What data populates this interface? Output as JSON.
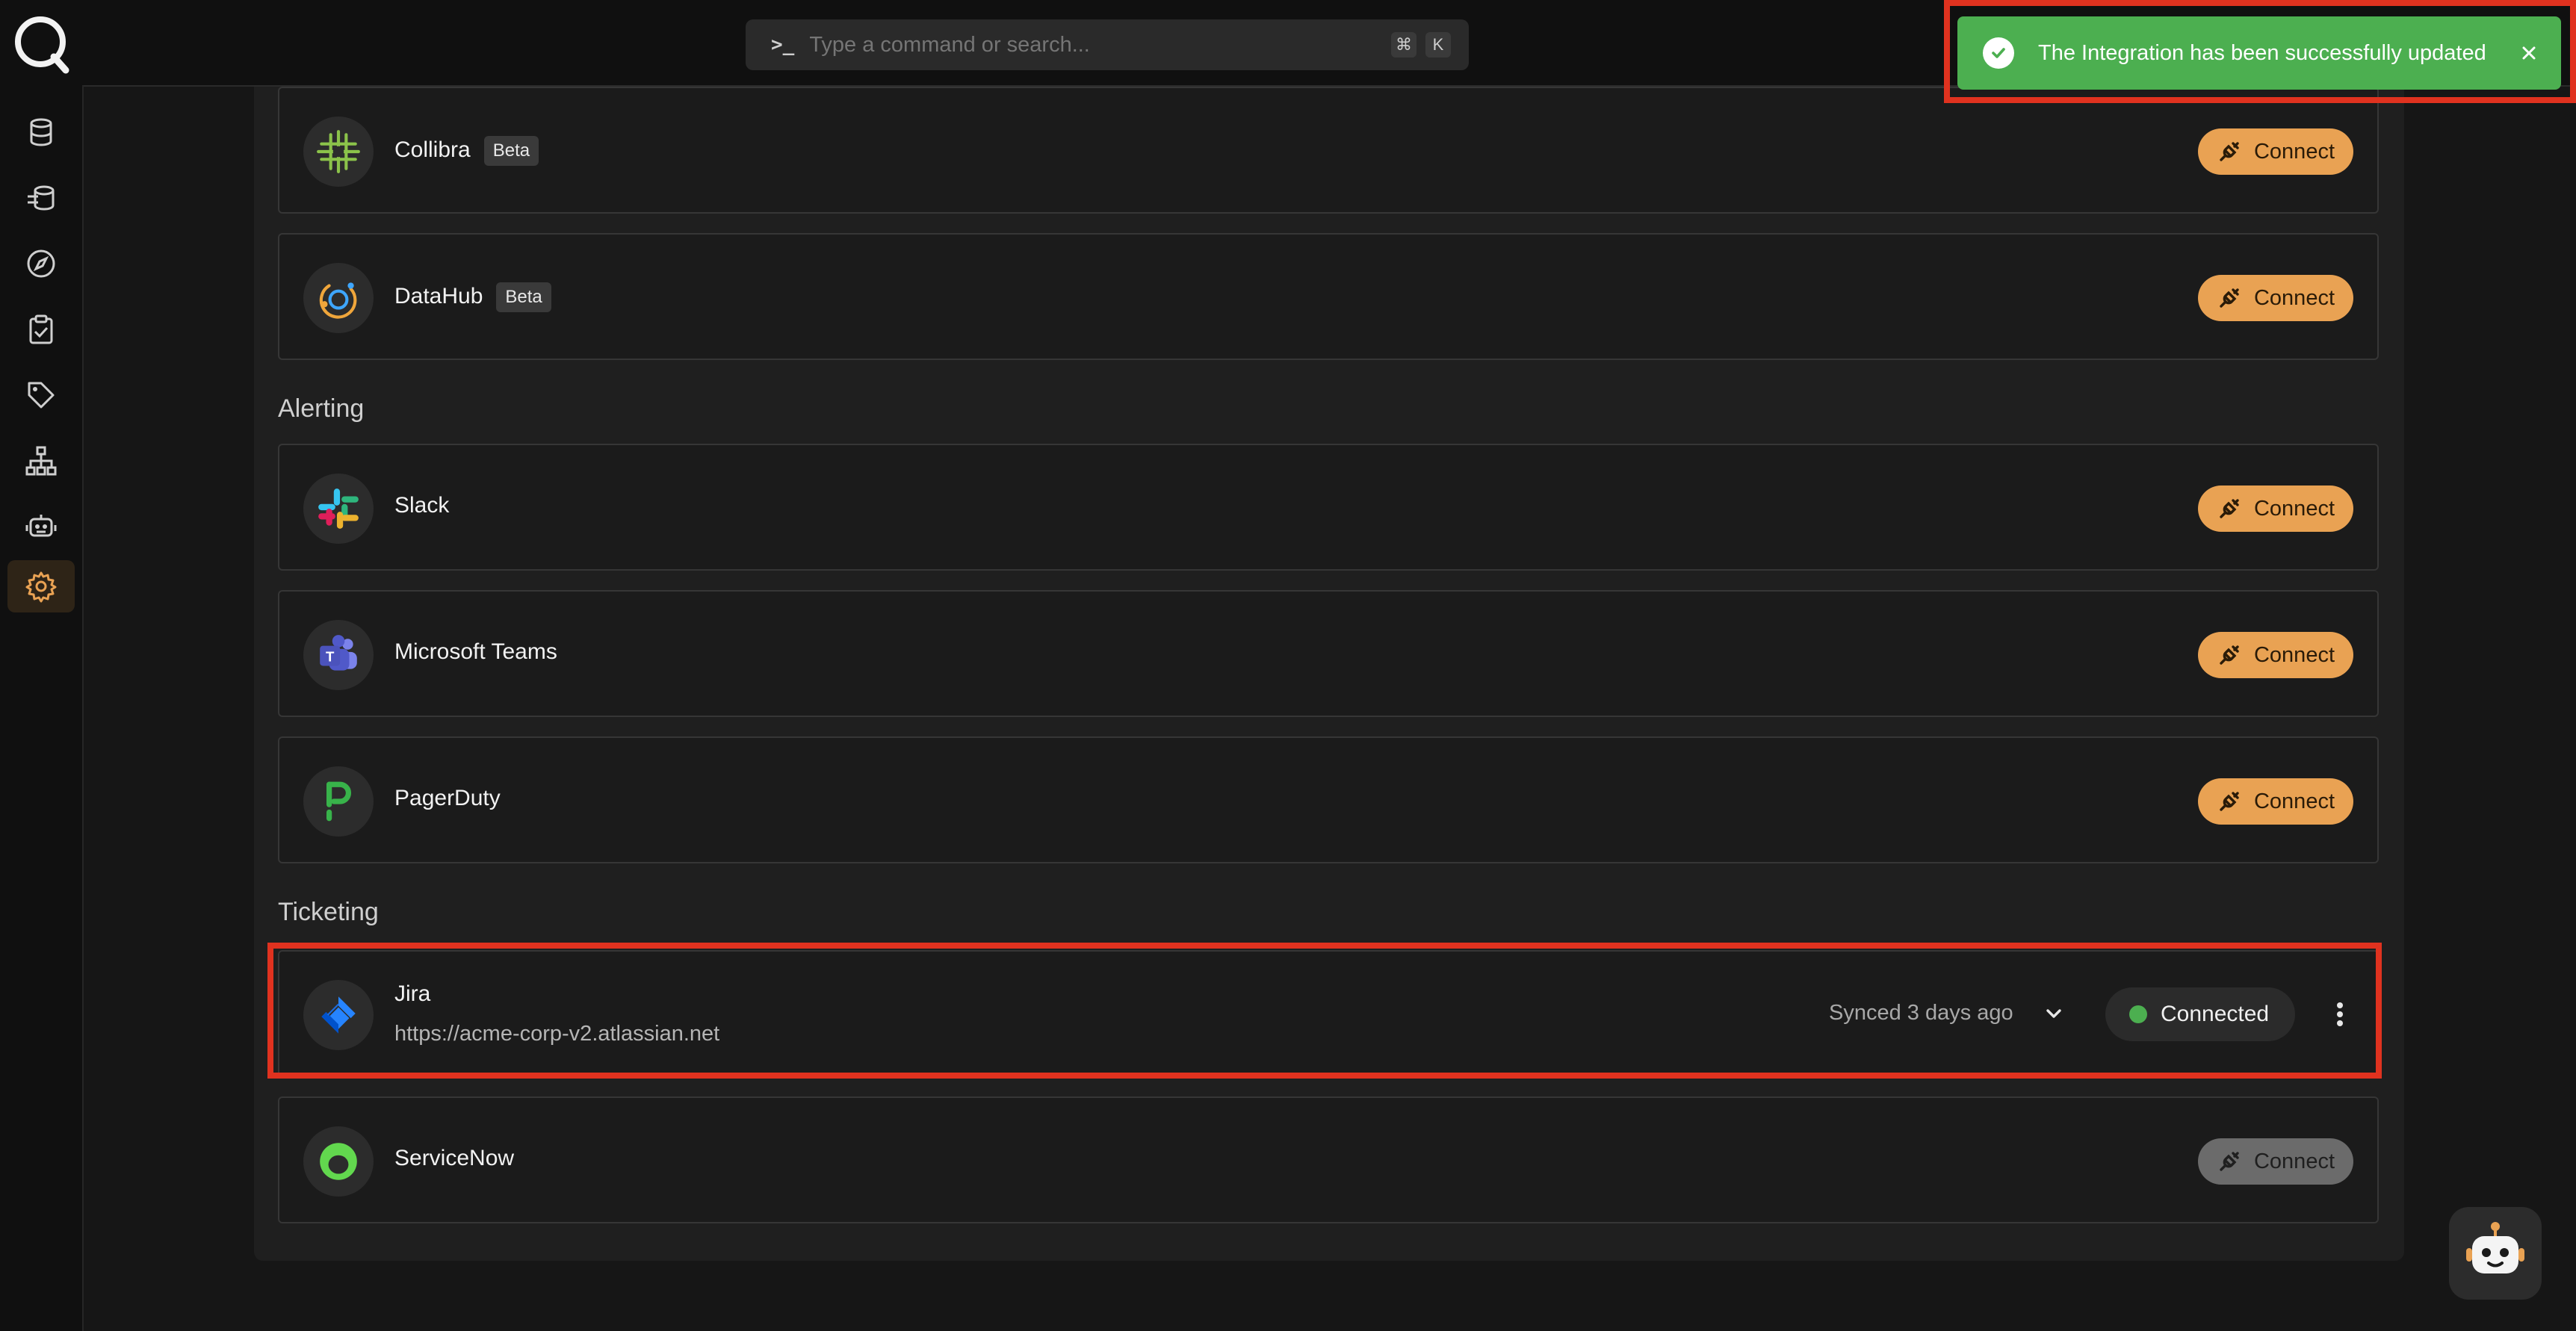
{
  "topbar": {
    "search_placeholder": "Type a command or search...",
    "kbd_cmd": "⌘",
    "kbd_key": "K"
  },
  "toast": {
    "message": "The Integration has been successfully updated"
  },
  "sections": {
    "alerting": "Alerting",
    "ticketing": "Ticketing"
  },
  "integrations": {
    "collibra": {
      "name": "Collibra",
      "badge": "Beta",
      "action": "Connect"
    },
    "datahub": {
      "name": "DataHub",
      "badge": "Beta",
      "action": "Connect"
    },
    "slack": {
      "name": "Slack",
      "action": "Connect"
    },
    "teams": {
      "name": "Microsoft Teams",
      "action": "Connect"
    },
    "pagerduty": {
      "name": "PagerDuty",
      "action": "Connect"
    },
    "jira": {
      "name": "Jira",
      "url": "https://acme-corp-v2.atlassian.net",
      "synced": "Synced 3 days ago",
      "status": "Connected"
    },
    "servicenow": {
      "name": "ServiceNow",
      "action": "Connect"
    }
  },
  "colors": {
    "accent": "#e9a253",
    "success": "#4caf50",
    "highlight": "#e0321f"
  },
  "icons": {
    "sidebar": [
      "database-icon",
      "pipeline-icon",
      "compass-icon",
      "clipboard-check-icon",
      "tag-icon",
      "hierarchy-icon",
      "robot-icon",
      "gear-icon"
    ]
  }
}
